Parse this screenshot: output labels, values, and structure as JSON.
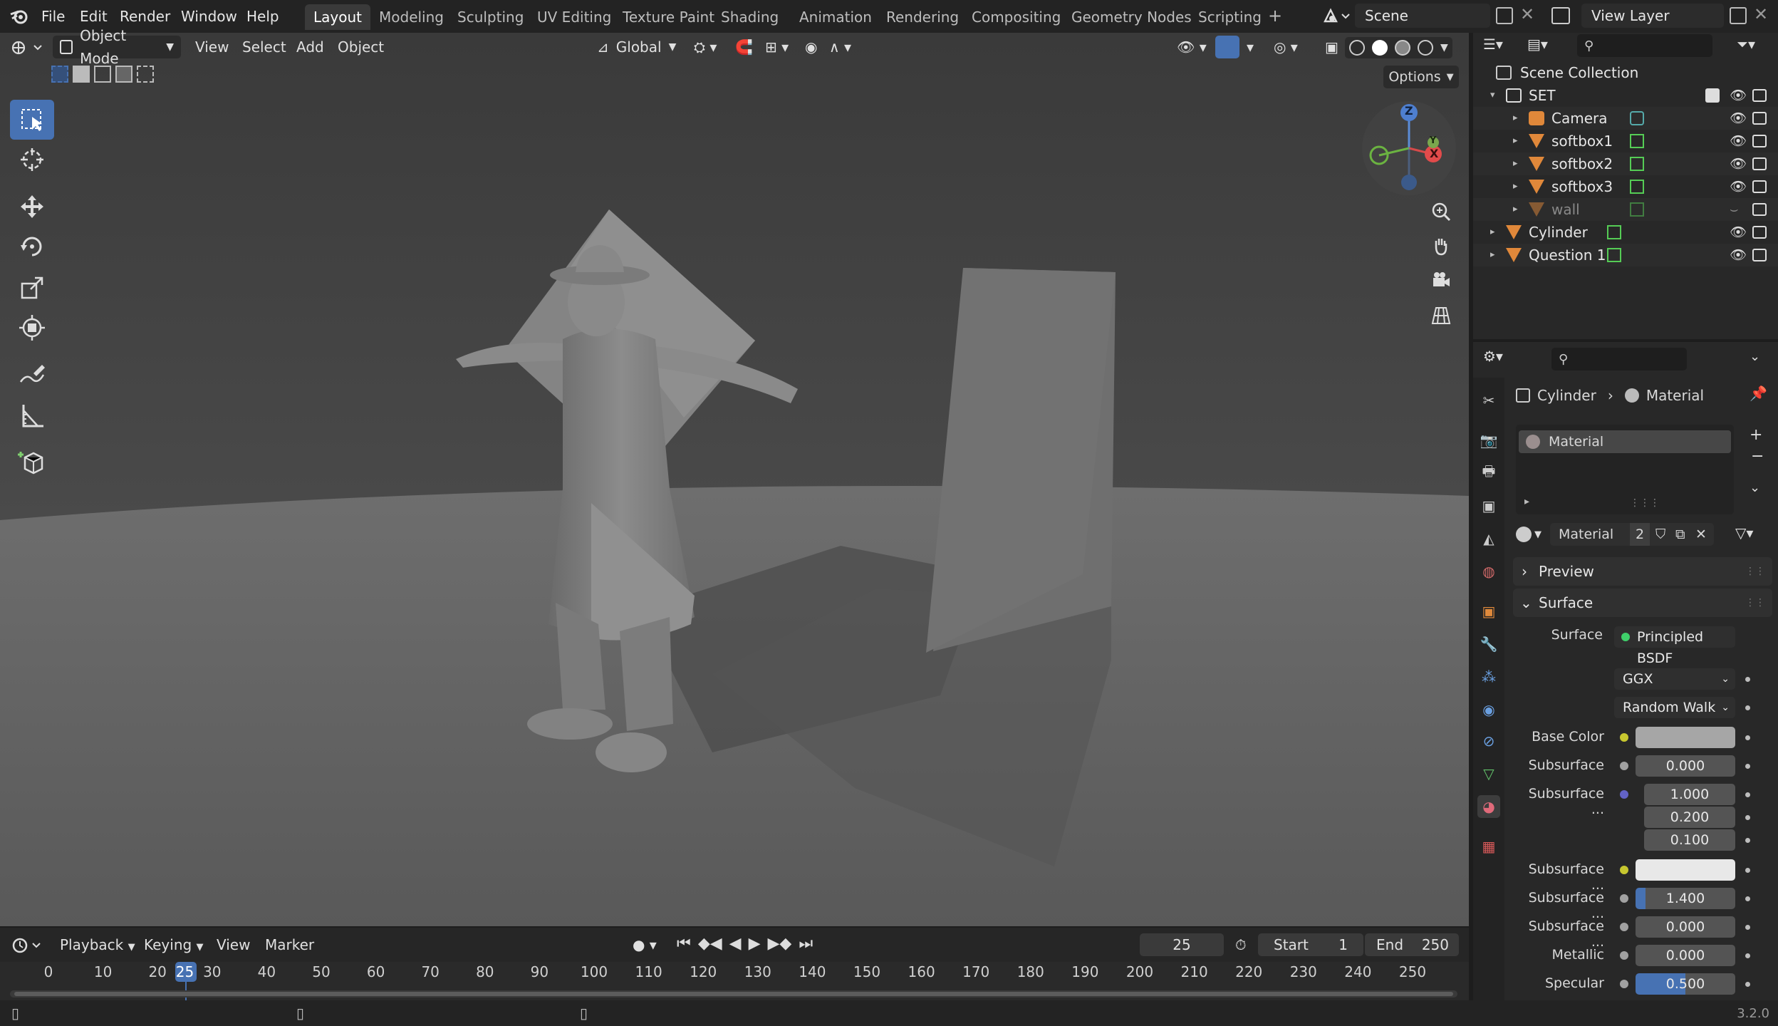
{
  "topbar": {
    "menus": [
      "File",
      "Edit",
      "Render",
      "Window",
      "Help"
    ],
    "workspaces": [
      "Layout",
      "Modeling",
      "Sculpting",
      "UV Editing",
      "Texture Paint",
      "Shading",
      "Animation",
      "Rendering",
      "Compositing",
      "Geometry Nodes",
      "Scripting"
    ],
    "active_workspace": "Layout",
    "scene": "Scene",
    "view_layer": "View Layer"
  },
  "viewport": {
    "mode": "Object Mode",
    "menus": [
      "View",
      "Select",
      "Add",
      "Object"
    ],
    "orientation": "Global",
    "options_label": "Options",
    "gizmo_axes": {
      "z": "Z",
      "y": "Y",
      "x": "X"
    }
  },
  "timeline": {
    "menus": [
      "Playback",
      "Keying",
      "View",
      "Marker"
    ],
    "current_frame": "25",
    "start_label": "Start",
    "start": "1",
    "end_label": "End",
    "end": "250",
    "frame_labels": [
      "0",
      "10",
      "20",
      "25",
      "30",
      "40",
      "50",
      "60",
      "70",
      "80",
      "90",
      "100",
      "110",
      "120",
      "130",
      "140",
      "150",
      "160",
      "170",
      "180",
      "190",
      "200",
      "210",
      "220",
      "230",
      "240",
      "250"
    ]
  },
  "outliner": {
    "root": "Scene Collection",
    "items": [
      {
        "name": "SET",
        "type": "collection"
      },
      {
        "name": "Camera",
        "type": "camera"
      },
      {
        "name": "softbox1",
        "type": "mesh"
      },
      {
        "name": "softbox2",
        "type": "mesh"
      },
      {
        "name": "softbox3",
        "type": "mesh"
      },
      {
        "name": "wall",
        "type": "mesh"
      },
      {
        "name": "Cylinder",
        "type": "mesh"
      },
      {
        "name": "Question 1",
        "type": "mesh"
      }
    ]
  },
  "properties": {
    "breadcrumb_object": "Cylinder",
    "breadcrumb_material": "Material",
    "slot_name": "Material",
    "material_name": "Material",
    "material_users": "2",
    "panel_preview": "Preview",
    "panel_surface": "Surface",
    "surface_label": "Surface",
    "surface_shader": "Principled BSDF",
    "distribution": "GGX",
    "subsurface_method": "Random Walk",
    "rows": [
      {
        "label": "Base Color",
        "value": "",
        "socket": "#c7c72f"
      },
      {
        "label": "Subsurface",
        "value": "0.000",
        "socket": "#a1a1a1"
      },
      {
        "label": "Subsurface ...",
        "value": "1.000",
        "socket": "#6363c7"
      },
      {
        "label": "",
        "value": "0.200",
        "socket": ""
      },
      {
        "label": "",
        "value": "0.100",
        "socket": ""
      },
      {
        "label": "Subsurface ...",
        "value": "",
        "socket": "#c7c72f"
      },
      {
        "label": "Subsurface ...",
        "value": "1.400",
        "socket": "#a1a1a1"
      },
      {
        "label": "Subsurface ...",
        "value": "0.000",
        "socket": "#a1a1a1"
      },
      {
        "label": "Metallic",
        "value": "0.000",
        "socket": "#a1a1a1"
      },
      {
        "label": "Specular",
        "value": "0.500",
        "socket": "#a1a1a1"
      }
    ],
    "specular_fill": 0.5,
    "subsurface_ior_fill": 0.1
  },
  "statusbar": {
    "version": "3.2.0"
  },
  "colors": {
    "accent": "#4772b3",
    "viewport_bg": "#3d3d3d",
    "panel_bg": "#282828"
  }
}
